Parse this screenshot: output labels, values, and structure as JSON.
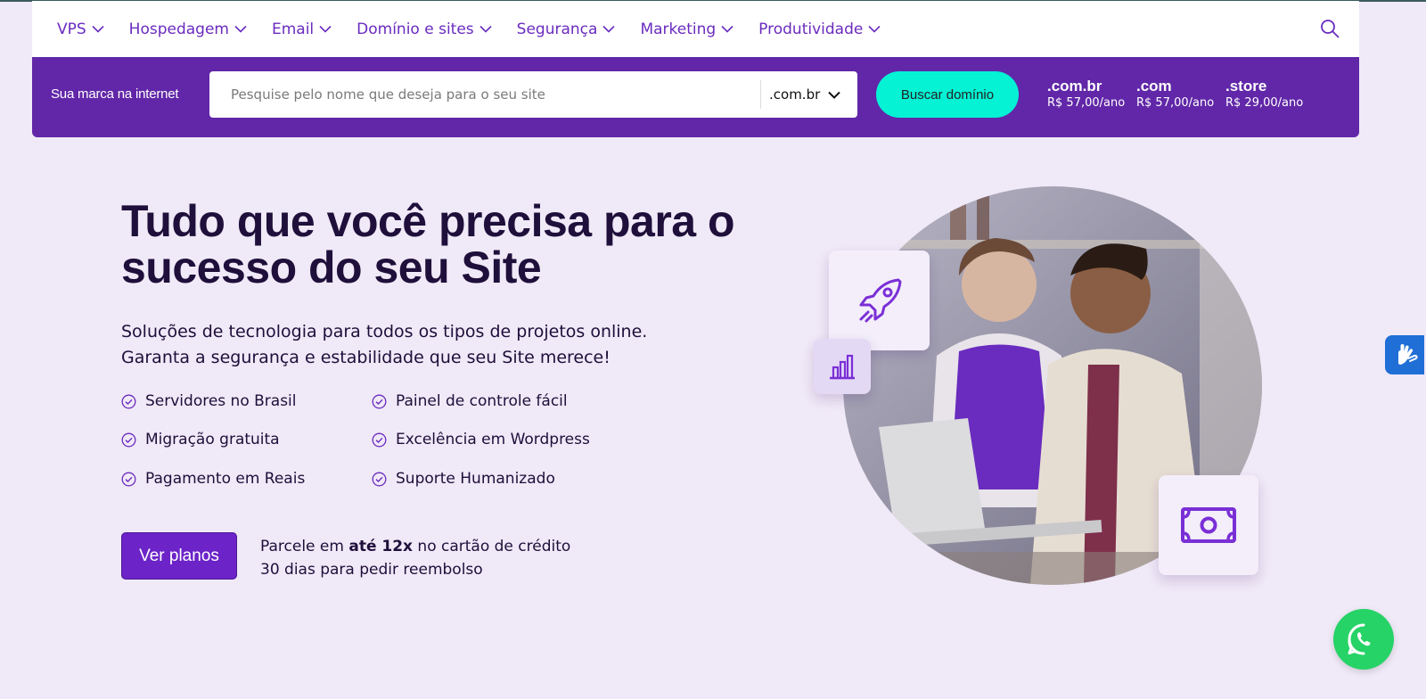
{
  "nav": {
    "items": [
      {
        "label": "VPS"
      },
      {
        "label": "Hospedagem"
      },
      {
        "label": "Email"
      },
      {
        "label": "Domínio e sites"
      },
      {
        "label": "Segurança"
      },
      {
        "label": "Marketing"
      },
      {
        "label": "Produtividade"
      }
    ],
    "search_icon": "search-icon"
  },
  "domain_bar": {
    "label": "Sua marca na internet",
    "search_placeholder": "Pesquise pelo nome que deseja para o seu site",
    "tld_selected": ".com.br",
    "button_label": "Buscar domínio",
    "prices": [
      {
        "tld": ".com.br",
        "price": "R$ 57,00/ano"
      },
      {
        "tld": ".com",
        "price": "R$ 57,00/ano"
      },
      {
        "tld": ".store",
        "price": "R$ 29,00/ano"
      }
    ]
  },
  "hero": {
    "title_line1": "Tudo que você precisa para o",
    "title_line2": "sucesso do seu Site",
    "subtitle_line1": "Soluções de tecnologia para todos os tipos de projetos online.",
    "subtitle_line2": "Garanta a segurança e estabilidade que seu Site merece!",
    "features": [
      "Servidores no Brasil",
      "Painel de controle fácil",
      "Migração gratuita",
      "Excelência em Wordpress",
      "Pagamento em Reais",
      "Suporte Humanizado"
    ],
    "cta_label": "Ver planos",
    "note_pre": "Parcele em ",
    "note_bold": "até 12x",
    "note_post": " no cartão de crédito",
    "note_line2": "30 dias para pedir reembolso"
  },
  "colors": {
    "accent": "#6127a8",
    "accent_text": "#6a2bbf",
    "cta": "#6c23c8",
    "domain_button": "#05f2d5",
    "background": "#f0e9f7",
    "whatsapp": "#25d366",
    "accessibility": "#1f6fd6"
  },
  "icons": {
    "rocket": "rocket-icon",
    "chart": "bar-chart-icon",
    "money": "money-icon",
    "accessibility": "sign-language-icon",
    "whatsapp": "whatsapp-icon"
  }
}
